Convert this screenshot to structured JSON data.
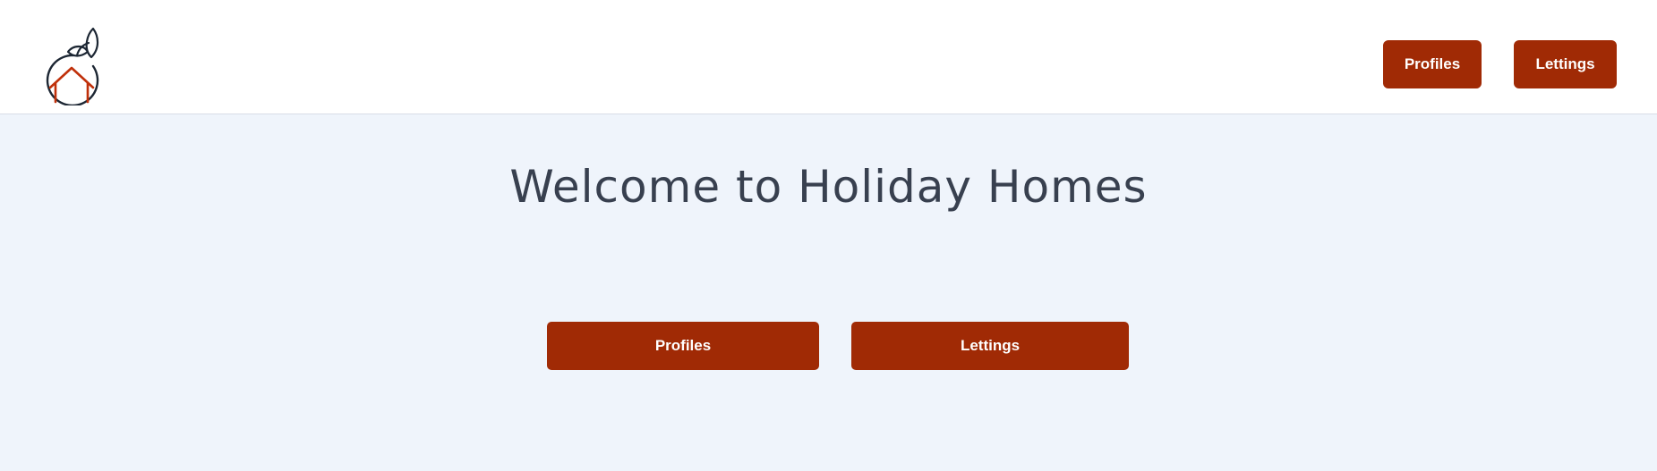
{
  "header": {
    "logo_icon": "holiday-homes-logo-icon",
    "nav": {
      "profiles_label": "Profiles",
      "lettings_label": "Lettings"
    }
  },
  "main": {
    "title": "Welcome to Holiday Homes",
    "buttons": {
      "profiles_label": "Profiles",
      "lettings_label": "Lettings"
    }
  },
  "colors": {
    "accent": "#a02a05",
    "page_background": "#eff4fb",
    "header_background": "#ffffff",
    "title_text": "#38404f",
    "logo_stroke": "#1c2633",
    "logo_house": "#c0300a"
  }
}
